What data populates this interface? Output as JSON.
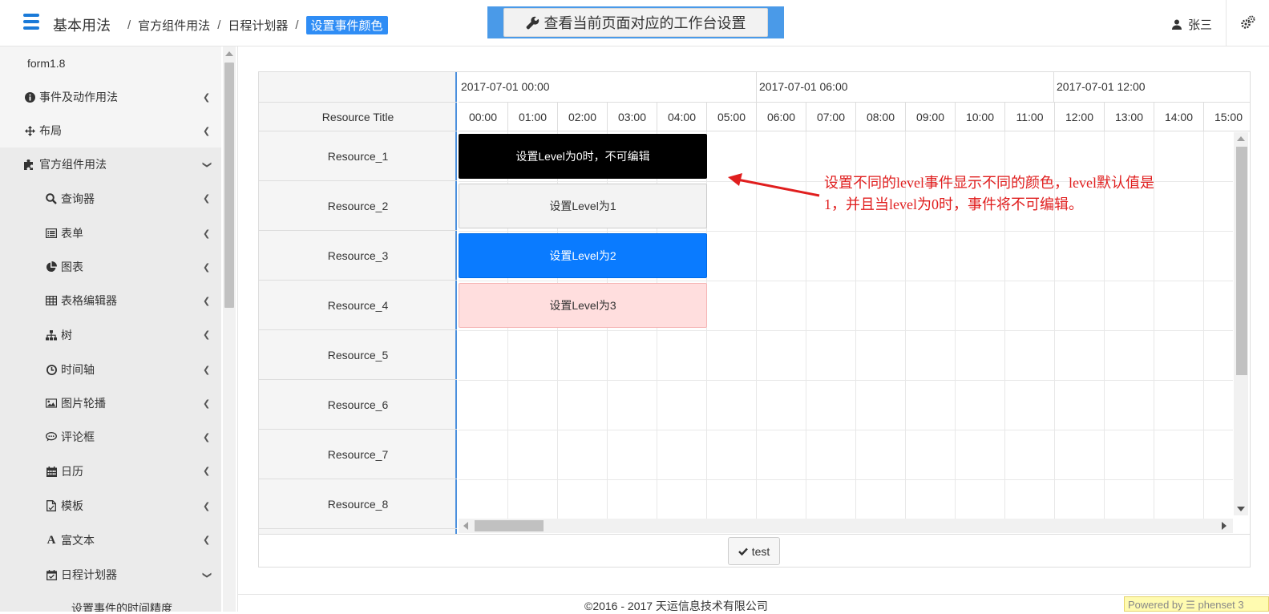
{
  "header": {
    "breadcrumb_root": "基本用法",
    "breadcrumb": [
      "官方组件用法",
      "日程计划器",
      "设置事件颜色"
    ],
    "workspace_button": "查看当前页面对应的工作台设置",
    "user_name": "张三"
  },
  "sidebar": {
    "title": "form1.8",
    "items": [
      {
        "label": "事件及动作用法",
        "icon": "info-circle-icon",
        "expanded": false
      },
      {
        "label": "布局",
        "icon": "arrows-icon",
        "expanded": false
      },
      {
        "label": "官方组件用法",
        "icon": "puzzle-icon",
        "expanded": true
      },
      {
        "label": "查询器",
        "icon": "search-icon",
        "expanded": false
      },
      {
        "label": "表单",
        "icon": "list-alt-icon",
        "expanded": false
      },
      {
        "label": "图表",
        "icon": "pie-chart-icon",
        "expanded": false
      },
      {
        "label": "表格编辑器",
        "icon": "table-icon",
        "expanded": false
      },
      {
        "label": "树",
        "icon": "sitemap-icon",
        "expanded": false
      },
      {
        "label": "时间轴",
        "icon": "clock-icon",
        "expanded": false
      },
      {
        "label": "图片轮播",
        "icon": "image-icon",
        "expanded": false
      },
      {
        "label": "评论框",
        "icon": "comment-icon",
        "expanded": false
      },
      {
        "label": "日历",
        "icon": "calendar-icon",
        "expanded": false
      },
      {
        "label": "模板",
        "icon": "file-icon",
        "expanded": false
      },
      {
        "label": "富文本",
        "icon": "font-icon",
        "expanded": false
      },
      {
        "label": "日程计划器",
        "icon": "calendar-check-icon",
        "expanded": true
      },
      {
        "label": "设置事件的时间精度",
        "icon": "",
        "expanded": false
      }
    ]
  },
  "scheduler": {
    "resource_header": "Resource Title",
    "days": [
      "2017-07-01 00:00",
      "2017-07-01 06:00",
      "2017-07-01 12:00"
    ],
    "hours": [
      "00:00",
      "01:00",
      "02:00",
      "03:00",
      "04:00",
      "05:00",
      "06:00",
      "07:00",
      "08:00",
      "09:00",
      "10:00",
      "11:00",
      "12:00",
      "13:00",
      "14:00",
      "15:00"
    ],
    "resources": [
      "Resource_1",
      "Resource_2",
      "Resource_3",
      "Resource_4",
      "Resource_5",
      "Resource_6",
      "Resource_7",
      "Resource_8"
    ],
    "events": [
      {
        "label": "设置Level为0时，不可编辑",
        "level": 0,
        "color": "#000000"
      },
      {
        "label": "设置Level为1",
        "level": 1,
        "color": "#f3f3f3"
      },
      {
        "label": "设置Level为2",
        "level": 2,
        "color": "#0a7bff"
      },
      {
        "label": "设置Level为3",
        "level": 3,
        "color": "#ffdede"
      }
    ]
  },
  "annotation": {
    "text": "设置不同的level事件显示不同的颜色，level默认值是1，并且当level为0时，事件将不可编辑。",
    "color": "#e01e1e"
  },
  "test_button": "test",
  "footer": {
    "copyright": "©2016 - 2017 天运信息技术有限公司",
    "powered_by": "Powered by ☰ phenset 3"
  },
  "colors": {
    "accent": "#2f8df5",
    "header_bar": "#4a9ae8"
  }
}
